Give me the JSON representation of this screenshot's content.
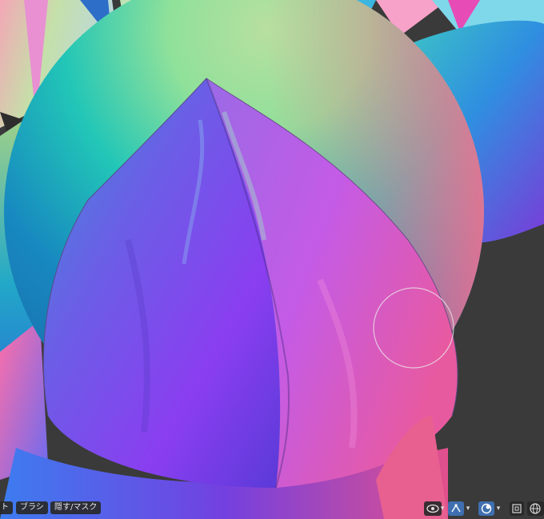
{
  "viewport": {
    "menu_items": [
      {
        "label": "ト"
      },
      {
        "label": "ブラシ"
      },
      {
        "label": "隠す/マスク"
      }
    ],
    "header_tools": [
      {
        "icon": "visibility-eye-icon",
        "active": false
      },
      {
        "icon": "gizmo-toggle-icon",
        "active": true
      },
      {
        "icon": "overlay-toggle-icon",
        "active": true
      },
      {
        "icon": "xray-toggle-icon",
        "active": false
      },
      {
        "icon": "wireframe-shading-icon",
        "active": false
      }
    ],
    "accent_color": "#3f6fb0"
  }
}
